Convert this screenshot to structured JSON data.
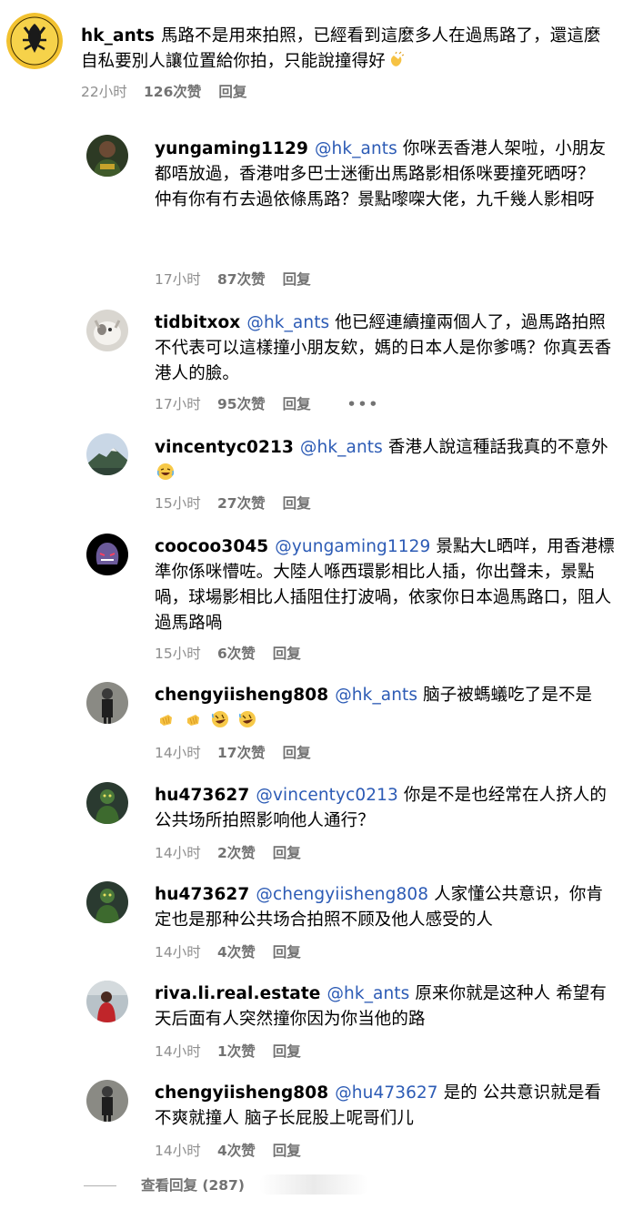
{
  "main_comment": {
    "username": "hk_ants",
    "text": "馬路不是用來拍照，已經看到這麼多人在過馬路了，還這麼自私要別人讓位置給你拍，只能說撞得好",
    "emoji": "clapping-hands-icon",
    "time": "22小时",
    "likes": "126次赞",
    "reply": "回复"
  },
  "replies": [
    {
      "username": "yungaming1129",
      "mention": "@hk_ants",
      "text": "你咪丟香港人架啦，小朋友都唔放過，香港咁多巴士迷衝出馬路影相係咪要撞死晒呀？\n仲有你有冇去過依條馬路？景點嚟㗎大佬，九千幾人影相呀",
      "time": "17小时",
      "likes": "87次赞",
      "reply": "回复"
    },
    {
      "username": "tidbitxox",
      "mention": "@hk_ants",
      "text": "他已經連續撞兩個人了，過馬路拍照不代表可以這樣撞小朋友欸，媽的日本人是你爹嗎？你真丟香港人的臉。",
      "time": "17小时",
      "likes": "95次赞",
      "reply": "回复",
      "more": "•••"
    },
    {
      "username": "vincentyc0213",
      "mention": "@hk_ants",
      "text": "香港人說這種話我真的不意外",
      "emoji": "laughing-face-icon",
      "time": "15小时",
      "likes": "27次赞",
      "reply": "回复"
    },
    {
      "username": "coocoo3045",
      "mention": "@yungaming1129",
      "text": "景點大L晒咩，用香港標準你係咪懵咗。大陸人喺西環影相比人插，你出聲未，景點喎，球場影相比人插阻住打波喎，依家你日本過馬路口，阻人過馬路喎",
      "time": "15小时",
      "likes": "6次赞",
      "reply": "回复"
    },
    {
      "username": "chengyiisheng808",
      "mention": "@hk_ants",
      "text": "脑子被螞蟻吃了是不是",
      "emojis": [
        "fist-icon",
        "fist-icon",
        "rofl-icon",
        "rofl-icon"
      ],
      "time": "14小时",
      "likes": "17次赞",
      "reply": "回复"
    },
    {
      "username": "hu473627",
      "mention": "@vincentyc0213",
      "text": "你是不是也经常在人挤人的公共场所拍照影响他人通行？",
      "time": "14小时",
      "likes": "2次赞",
      "reply": "回复"
    },
    {
      "username": "hu473627",
      "mention": "@chengyiisheng808",
      "text": "人家懂公共意识，你肯定也是那种公共场合拍照不顾及他人感受的人",
      "time": "14小时",
      "likes": "4次赞",
      "reply": "回复"
    },
    {
      "username": "riva.li.real.estate",
      "mention": "@hk_ants",
      "text": "原来你就是这种人 希望有天后面有人突然撞你因为你当他的路",
      "time": "14小时",
      "likes": "1次赞",
      "reply": "回复"
    },
    {
      "username": "chengyiisheng808",
      "mention": "@hu473627",
      "text": "是的 公共意识就是看不爽就撞人 脑子长屁股上呢哥们儿",
      "time": "14小时",
      "likes": "4次赞",
      "reply": "回复"
    }
  ],
  "view_replies": "查看回复 (287)",
  "colors": {
    "mention": "#2c5bb5",
    "meta": "#8e8e8e",
    "meta_bold": "#737373"
  }
}
